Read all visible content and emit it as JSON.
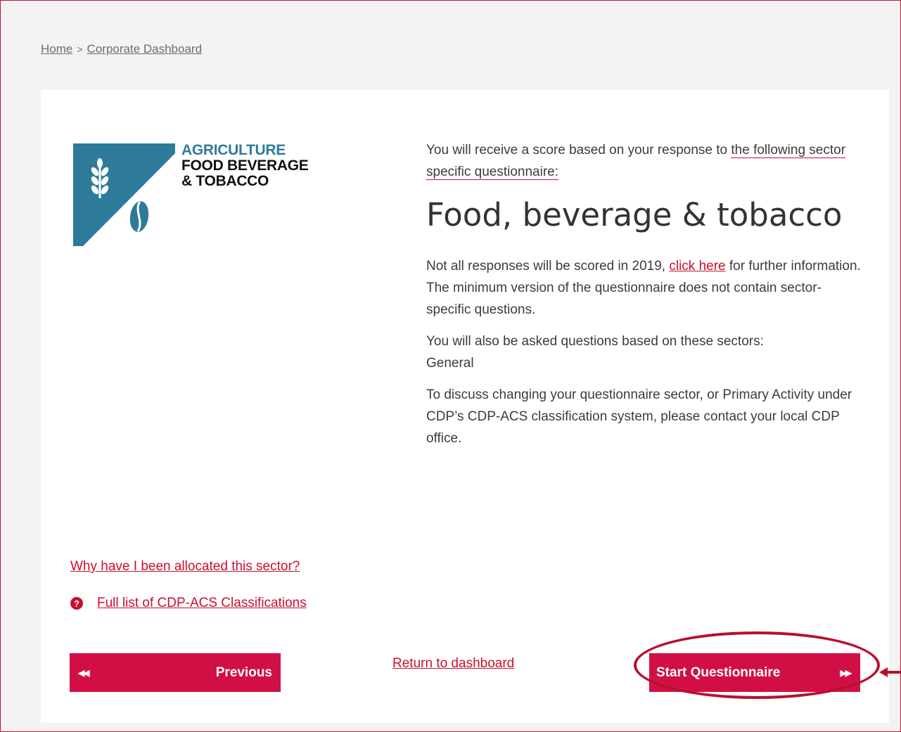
{
  "breadcrumb": {
    "home": "Home",
    "separator": ">",
    "current": "Corporate Dashboard"
  },
  "logo": {
    "line1": "AGRICULTURE",
    "line2": "FOOD BEVERAGE",
    "line3": "& TOBACCO",
    "icons": [
      "wheat-icon",
      "coffee-bean-icon"
    ],
    "colors": {
      "teal": "#2e7b99",
      "dark": "#111111"
    }
  },
  "intro": {
    "before_link": "You will receive a score based on your response to ",
    "link": "the following sector specific questionnaire:"
  },
  "sector_title": "Food, beverage & tobacco",
  "scoring_note": {
    "before_link": "Not all responses will be scored in 2019, ",
    "link": "click here",
    "after_link": " for further information.",
    "line2": "The minimum version of the questionnaire does not contain sector-specific questions."
  },
  "also_asked": {
    "line1": "You will also be asked questions based on these sectors:",
    "line2": "General"
  },
  "discuss": "To discuss changing your questionnaire sector, or Primary Activity under CDP’s CDP-ACS classification system, please contact your local CDP office.",
  "links": {
    "why_allocated": "Why have I been allocated this sector?",
    "full_list": "Full list of CDP-ACS Classifications",
    "return_dashboard": "Return to dashboard"
  },
  "buttons": {
    "previous": "Previous",
    "previous_icon": "◀◀",
    "start": "Start Questionnaire",
    "start_icon": "▶▶"
  },
  "help_icon": "?",
  "colors": {
    "accent": "#d20f45",
    "link_red": "#c8102e",
    "annotation": "#b8102e"
  }
}
